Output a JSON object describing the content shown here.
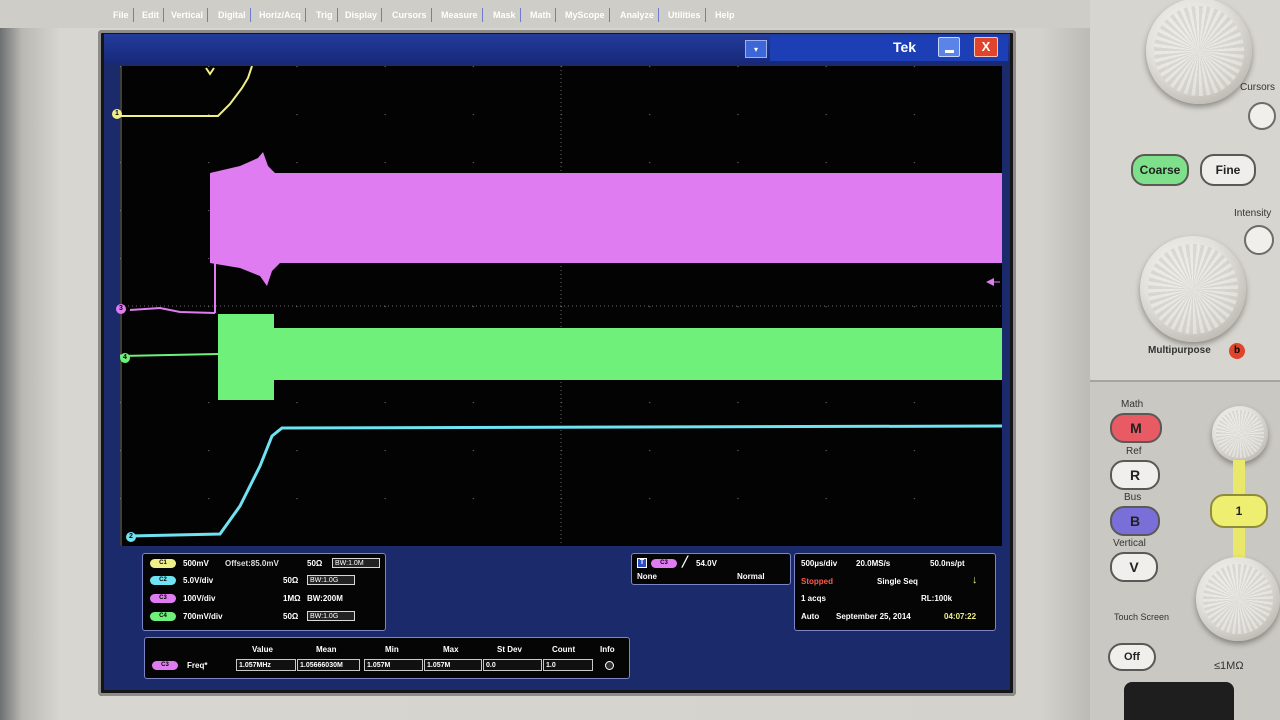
{
  "menu": {
    "items": [
      "File",
      "Edit",
      "Vertical",
      "Digital",
      "Horiz/Acq",
      "Trig",
      "Display",
      "Cursors",
      "Measure",
      "Mask",
      "Math",
      "MyScope",
      "Analyze",
      "Utilities",
      "Help"
    ],
    "brand": "Tek",
    "close_glyph": "X"
  },
  "markers": {
    "ch1": "1",
    "ch3": "3",
    "ch4": "4",
    "ch2": "2"
  },
  "channels": [
    {
      "chip": "C1",
      "scale": "500mV",
      "offset": "Offset:85.0mV",
      "imp": "50Ω",
      "bw": "BW:1.0M",
      "color": "#f0f089"
    },
    {
      "chip": "C2",
      "scale": "5.0V/div",
      "offset": "",
      "imp": "50Ω",
      "bw": "BW:1.0G",
      "color": "#6fe3f2"
    },
    {
      "chip": "C3",
      "scale": "100V/div",
      "offset": "",
      "imp": "1MΩ",
      "bw": "BW:200M",
      "color": "#e07cf2"
    },
    {
      "chip": "C4",
      "scale": "700mV/div",
      "offset": "",
      "imp": "50Ω",
      "bw": "BW:1.0G",
      "color": "#6ef07a"
    }
  ],
  "trigger": {
    "source": "C3",
    "level": "54.0V",
    "coupling": "None",
    "mode": "Normal",
    "glyph": "T"
  },
  "acquisition": {
    "timebase": "500µs/div",
    "sample_rate": "20.0MS/s",
    "resolution": "50.0ns/pt",
    "state": "Stopped",
    "seq": "Single Seq",
    "acqs": "1 acqs",
    "record": "RL:100k",
    "auto": "Auto",
    "date": "September 25, 2014",
    "time": "04:07:22"
  },
  "measurement": {
    "headers": [
      "Value",
      "Mean",
      "Min",
      "Max",
      "St Dev",
      "Count",
      "Info"
    ],
    "chip": "C3",
    "name": "Freq*",
    "values": [
      "1.057MHz",
      "1.05666030M",
      "1.057M",
      "1.057M",
      "0.0",
      "1.0"
    ]
  },
  "panel": {
    "cursors": "Cursors",
    "coarse": "Coarse",
    "fine": "Fine",
    "intensity": "Intensity",
    "multipurpose": "Multipurpose",
    "multipurpose_badge": "b",
    "math": "Math",
    "math_btn": "M",
    "ref": "Ref",
    "ref_btn": "R",
    "bus": "Bus",
    "bus_btn": "B",
    "vertical": "Vertical",
    "vertical_btn": "V",
    "ch1_btn": "1",
    "touch_screen": "Touch Screen",
    "off": "Off",
    "impedance": "≤1MΩ"
  },
  "colors": {
    "ch1": "#f0f089",
    "ch2": "#6fe3f2",
    "ch3": "#e07cf2",
    "ch4": "#6ef07a",
    "menubar": "#1c3596",
    "math_btn": "#e85a64",
    "bus_btn": "#7a6fd8",
    "coarse_btn": "#7ee08a"
  }
}
